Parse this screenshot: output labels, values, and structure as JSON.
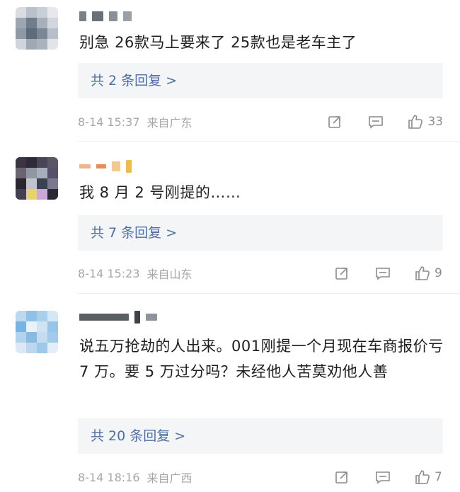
{
  "comments": [
    {
      "text": "别急 26款马上要来了 25款也是老车主了",
      "replies": "共 2 条回复 >",
      "time": "8-14 15:37",
      "location": "来自广东",
      "likes": "33"
    },
    {
      "text": "我 8 月 2 号刚提的……",
      "replies": "共 7 条回复 >",
      "time": "8-14 15:23",
      "location": "来自山东",
      "likes": "9"
    },
    {
      "text": "说五万抢劫的人出来。001刚提一个月现在车商报价亏 7 万。要 5 万过分吗？未经他人苦莫劝他人善",
      "replies": "共 20 条回复 >",
      "time": "8-14 18:16",
      "location": "来自广西",
      "likes": "7"
    }
  ],
  "icons": {
    "share": "share-icon",
    "comment": "comment-icon",
    "like": "like-icon"
  },
  "colors": {
    "reply_link": "#4e6fa6",
    "reply_bg": "#f4f5f7",
    "meta_text": "#a6a6a6"
  }
}
